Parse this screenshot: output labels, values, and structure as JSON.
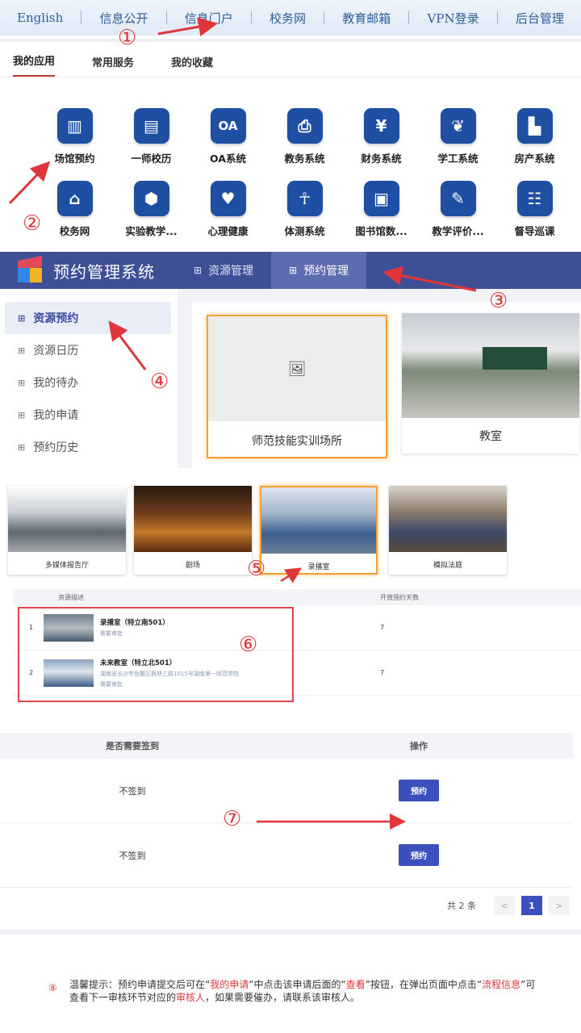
{
  "topnav": [
    "English",
    "信息公开",
    "信息门户",
    "校务网",
    "教育邮箱",
    "VPN登录",
    "后台管理"
  ],
  "app_panel": {
    "tabs": [
      "我的应用",
      "常用服务",
      "我的收藏"
    ],
    "apps": [
      {
        "label": "场馆预约",
        "icon": "building-icon"
      },
      {
        "label": "一师校历",
        "icon": "calendar-icon"
      },
      {
        "label": "OA系统",
        "icon": "oa-icon"
      },
      {
        "label": "教务系统",
        "icon": "printer-icon"
      },
      {
        "label": "财务系统",
        "icon": "moneybag-icon"
      },
      {
        "label": "学工系统",
        "icon": "lotus-icon"
      },
      {
        "label": "房产系统",
        "icon": "house-icon"
      },
      {
        "label": "校务网",
        "icon": "school-icon"
      },
      {
        "label": "实验教学...",
        "icon": "cube-icon"
      },
      {
        "label": "心理健康",
        "icon": "heart-chat-icon"
      },
      {
        "label": "体测系统",
        "icon": "person-icon"
      },
      {
        "label": "图书馆数...",
        "icon": "monitor-icon"
      },
      {
        "label": "教学评价...",
        "icon": "edit-icon"
      },
      {
        "label": "督导巡课",
        "icon": "people-icon"
      }
    ]
  },
  "system": {
    "title": "预约管理系统",
    "tabs": [
      "资源管理",
      "预约管理"
    ],
    "sidebar": [
      "资源预约",
      "资源日历",
      "我的待办",
      "我的申请",
      "预约历史"
    ],
    "cards": [
      "师范技能实训场所",
      "教室"
    ]
  },
  "venues": [
    "多媒体报告厅",
    "剧场",
    "录播室",
    "模拟法庭"
  ],
  "resource_table": {
    "headers": [
      "资源描述",
      "开放预约天数"
    ],
    "rows": [
      {
        "no": "1",
        "name": "录播室（特立南501）",
        "address": "",
        "note": "需要审批",
        "days": "7"
      },
      {
        "no": "2",
        "name": "未来教室（特立北501）",
        "address": "湖南省长沙市岳麓区枫林三路1015号湖南第一师范学院",
        "note": "需要审批",
        "days": "7"
      }
    ]
  },
  "action_table": {
    "headers": [
      "是否需要签到",
      "操作"
    ],
    "rows": [
      {
        "signin": "不签到",
        "action": "预约"
      },
      {
        "signin": "不签到",
        "action": "预约"
      }
    ]
  },
  "pager": {
    "total": "共 2 条",
    "prev": "<",
    "current": "1",
    "next": ">"
  },
  "tip": {
    "num": "⑧",
    "p1": "温馨提示：预约申请提交后可在“",
    "r1": "我的申请",
    "p2": "”中点击该申请后面的“",
    "r2": "查看",
    "p3": "”按钮，在弹出页面中点击“",
    "r3": "流程信息",
    "p4": "”可查看下一审核环节对应的",
    "r4": "审核人",
    "p5": "，如果需要催办，请联系该审核人。"
  },
  "annotations": [
    "①",
    "②",
    "③",
    "④",
    "⑤",
    "⑥",
    "⑦"
  ],
  "colors": {
    "brand": "#3f4f96",
    "accent": "#f5a033",
    "button": "#3b4fbd",
    "annotation": "#e0363b"
  }
}
